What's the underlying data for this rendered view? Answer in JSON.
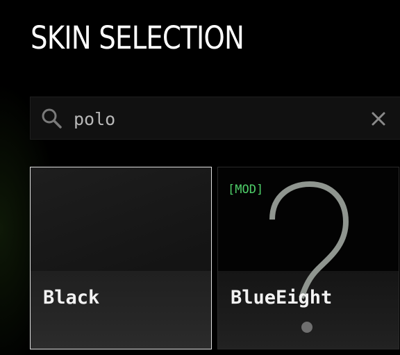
{
  "header": {
    "title": "SKIN SELECTION"
  },
  "search": {
    "value": "polo",
    "icon": "search-icon",
    "clear_icon": "close-icon"
  },
  "skins": [
    {
      "name": "Black",
      "selected": true,
      "tag": ""
    },
    {
      "name": "BlueEight",
      "selected": false,
      "tag": "[MOD]",
      "preview_icon": "question-mark-icon"
    }
  ],
  "colors": {
    "background": "#000000",
    "mod_tag": "#4fd06a",
    "selected_border": "#e0e0e0",
    "text": "#ffffff"
  }
}
